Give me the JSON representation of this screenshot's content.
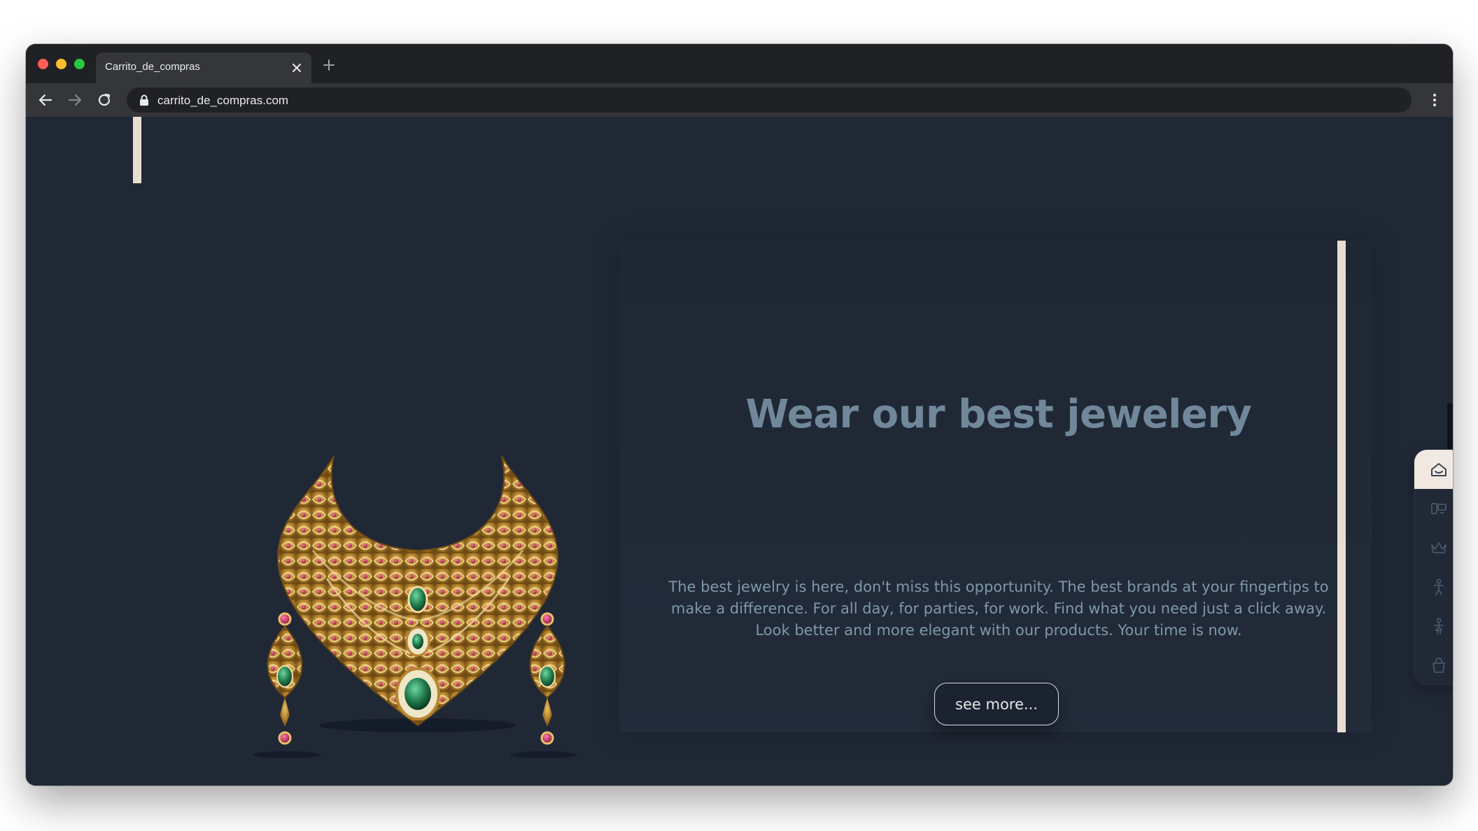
{
  "window": {
    "tab_title": "Carrito_de_compras",
    "url": "carrito_de_compras.com"
  },
  "hero": {
    "title": "Wear our best jewelery",
    "description": "The best jewelry is here, don't miss this opportunity. The best brands at your fingertips to make a difference. For all day, for parties, for work. Find what you need just a click away. Look better and more elegant with our products. Your time is now.",
    "cta_label": "see more..."
  },
  "sidebar": {
    "items": [
      {
        "icon": "home-icon",
        "active": true
      },
      {
        "icon": "electronics-icon",
        "active": false
      },
      {
        "icon": "crown-icon",
        "active": false
      },
      {
        "icon": "men-icon",
        "active": false
      },
      {
        "icon": "women-icon",
        "active": false
      },
      {
        "icon": "shopping-bag-icon",
        "active": false
      }
    ]
  },
  "colors": {
    "page_bg": "#202836",
    "accent_bar": "#e9ddd2",
    "title_color": "#70889a",
    "text_color": "#7f98aa",
    "button_border": "#d8dde3"
  }
}
